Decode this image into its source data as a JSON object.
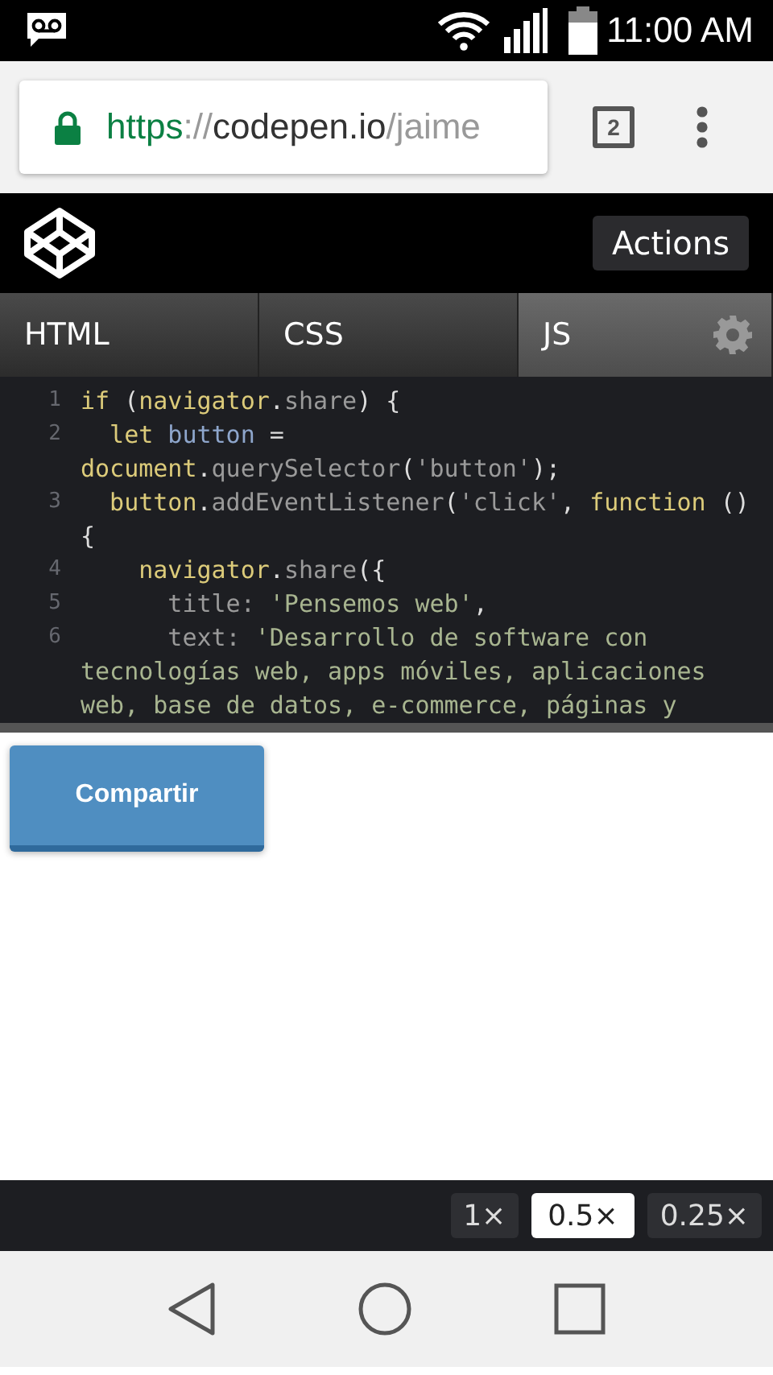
{
  "status_bar": {
    "time": "11:00 AM"
  },
  "browser": {
    "url_scheme": "https",
    "url_separator": "://",
    "url_host": "codepen.io",
    "url_path": "/jaime",
    "tab_count": "2"
  },
  "codepen": {
    "actions_button": "Actions",
    "tabs": [
      {
        "label": "HTML",
        "selected": false
      },
      {
        "label": "CSS",
        "selected": false
      },
      {
        "label": "JS",
        "selected": true
      }
    ],
    "code_lines": [
      {
        "number": "1",
        "tokens": [
          {
            "t": "if",
            "kind": "keyword"
          },
          {
            "t": " (",
            "kind": "plain"
          },
          {
            "t": "navigator",
            "kind": "keyword"
          },
          {
            "t": ".",
            "kind": "plain"
          },
          {
            "t": "share",
            "kind": "property"
          },
          {
            "t": ") {",
            "kind": "plain"
          }
        ]
      },
      {
        "number": "2",
        "tokens": [
          {
            "t": "  let",
            "kind": "keyword"
          },
          {
            "t": " button",
            "kind": "variable"
          },
          {
            "t": " =",
            "kind": "plain"
          }
        ]
      },
      {
        "tokens": [
          {
            "t": "document",
            "kind": "keyword"
          },
          {
            "t": ".",
            "kind": "plain"
          },
          {
            "t": "querySelector",
            "kind": "property"
          },
          {
            "t": "(",
            "kind": "plain"
          },
          {
            "t": "'button'",
            "kind": "property"
          },
          {
            "t": ");",
            "kind": "plain"
          }
        ]
      },
      {
        "number": "3",
        "tokens": [
          {
            "t": "  button",
            "kind": "keyword"
          },
          {
            "t": ".",
            "kind": "plain"
          },
          {
            "t": "addEventListener",
            "kind": "property"
          },
          {
            "t": "(",
            "kind": "plain"
          },
          {
            "t": "'click'",
            "kind": "property"
          },
          {
            "t": ", ",
            "kind": "plain"
          },
          {
            "t": "function",
            "kind": "keyword"
          },
          {
            "t": " ()",
            "kind": "plain"
          }
        ]
      },
      {
        "tokens": [
          {
            "t": "{",
            "kind": "plain"
          }
        ]
      },
      {
        "number": "4",
        "tokens": [
          {
            "t": "    navigator",
            "kind": "keyword"
          },
          {
            "t": ".",
            "kind": "plain"
          },
          {
            "t": "share",
            "kind": "property"
          },
          {
            "t": "({",
            "kind": "plain"
          }
        ]
      },
      {
        "number": "5",
        "tokens": [
          {
            "t": "      title: ",
            "kind": "property"
          },
          {
            "t": "'Pensemos web'",
            "kind": "string"
          },
          {
            "t": ",",
            "kind": "plain"
          }
        ]
      },
      {
        "number": "6",
        "tokens": [
          {
            "t": "      text: ",
            "kind": "property"
          },
          {
            "t": "'Desarrollo de software con",
            "kind": "string"
          }
        ]
      },
      {
        "tokens": [
          {
            "t": "tecnologías web, apps móviles, aplicaciones",
            "kind": "string"
          }
        ]
      },
      {
        "tokens": [
          {
            "t": "web, base de datos, e-commerce, páginas y",
            "kind": "string"
          }
        ]
      }
    ],
    "preview_button": "Compartir",
    "zoom_options": [
      {
        "label": "1×",
        "selected": false
      },
      {
        "label": "0.5×",
        "selected": true
      },
      {
        "label": "0.25×",
        "selected": false
      }
    ]
  }
}
